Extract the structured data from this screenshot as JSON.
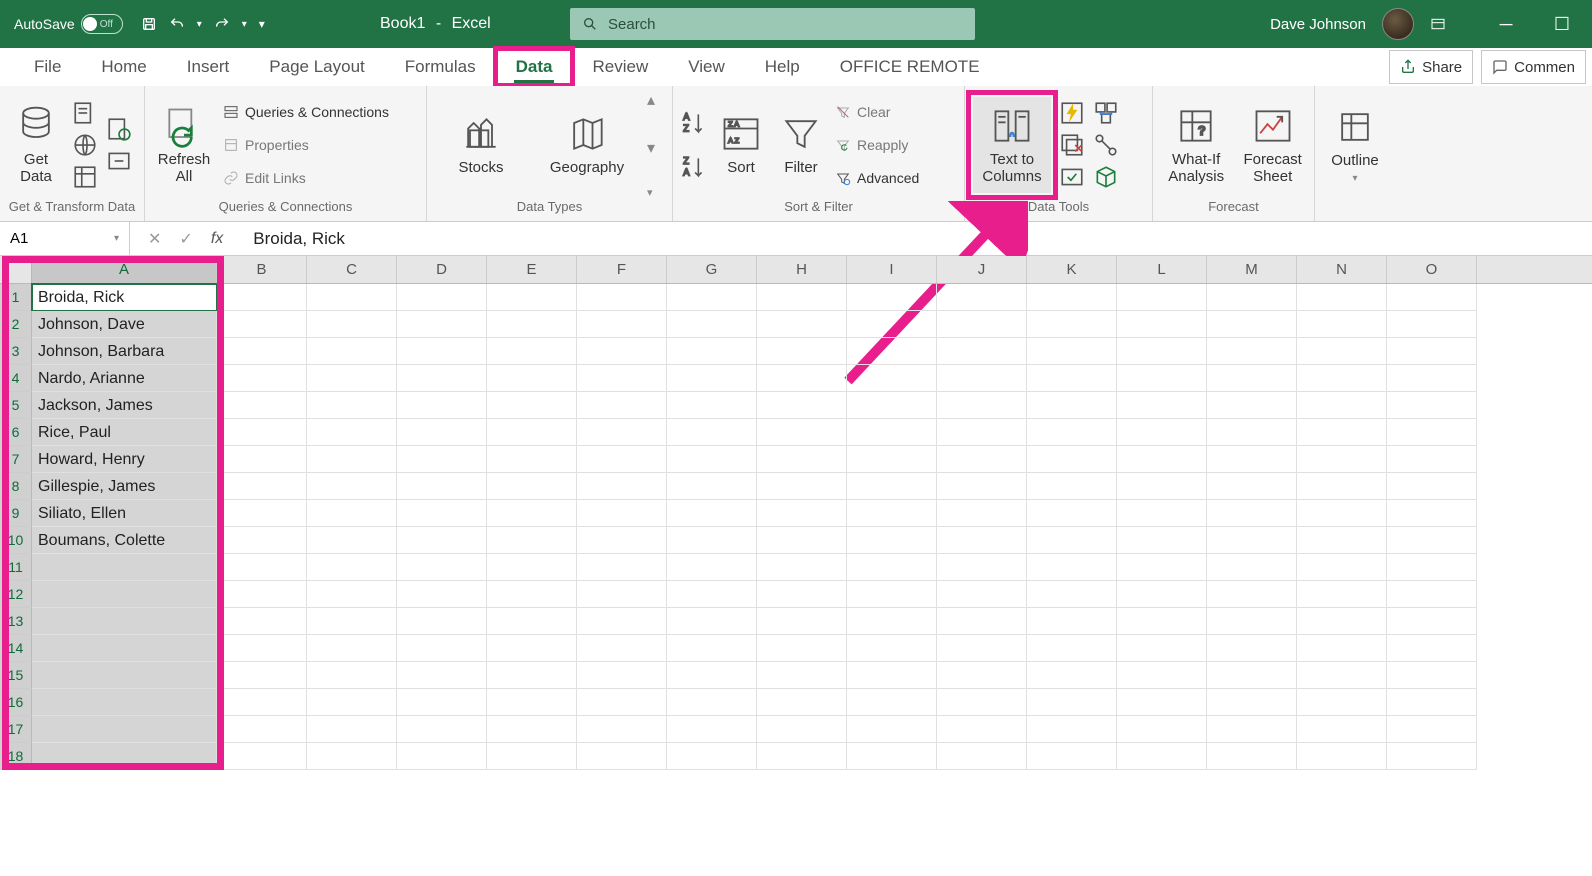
{
  "titlebar": {
    "autosave_label": "AutoSave",
    "autosave_state": "Off",
    "book_name": "Book1",
    "app_name": "Excel",
    "search_placeholder": "Search",
    "username": "Dave Johnson"
  },
  "tabs": {
    "file": "File",
    "home": "Home",
    "insert": "Insert",
    "page_layout": "Page Layout",
    "formulas": "Formulas",
    "data": "Data",
    "review": "Review",
    "view": "View",
    "help": "Help",
    "office_remote": "OFFICE REMOTE",
    "share": "Share",
    "comment": "Commen"
  },
  "ribbon": {
    "get_transform": {
      "get_data": "Get\nData",
      "label": "Get & Transform Data"
    },
    "queries": {
      "refresh_all": "Refresh\nAll",
      "queries_connections": "Queries & Connections",
      "properties": "Properties",
      "edit_links": "Edit Links",
      "label": "Queries & Connections"
    },
    "data_types": {
      "stocks": "Stocks",
      "geography": "Geography",
      "label": "Data Types"
    },
    "sort_filter": {
      "sort": "Sort",
      "filter": "Filter",
      "clear": "Clear",
      "reapply": "Reapply",
      "advanced": "Advanced",
      "label": "Sort & Filter"
    },
    "data_tools": {
      "text_to_columns": "Text to\nColumns",
      "label": "Data Tools"
    },
    "forecast": {
      "what_if": "What-If\nAnalysis",
      "forecast_sheet": "Forecast\nSheet",
      "label": "Forecast"
    },
    "outline": {
      "outline": "Outline"
    }
  },
  "formula_bar": {
    "name_box": "A1",
    "formula": "Broida, Rick"
  },
  "grid": {
    "columns": [
      "A",
      "B",
      "C",
      "D",
      "E",
      "F",
      "G",
      "H",
      "I",
      "J",
      "K",
      "L",
      "M",
      "N",
      "O"
    ],
    "rows": [
      {
        "n": 1,
        "A": "Broida, Rick"
      },
      {
        "n": 2,
        "A": "Johnson, Dave"
      },
      {
        "n": 3,
        "A": "Johnson, Barbara"
      },
      {
        "n": 4,
        "A": "Nardo, Arianne"
      },
      {
        "n": 5,
        "A": "Jackson, James"
      },
      {
        "n": 6,
        "A": "Rice, Paul"
      },
      {
        "n": 7,
        "A": "Howard, Henry"
      },
      {
        "n": 8,
        "A": "Gillespie, James"
      },
      {
        "n": 9,
        "A": "Siliato, Ellen"
      },
      {
        "n": 10,
        "A": "Boumans, Colette"
      },
      {
        "n": 11,
        "A": ""
      },
      {
        "n": 12,
        "A": ""
      },
      {
        "n": 13,
        "A": ""
      },
      {
        "n": 14,
        "A": ""
      },
      {
        "n": 15,
        "A": ""
      },
      {
        "n": 16,
        "A": ""
      },
      {
        "n": 17,
        "A": ""
      },
      {
        "n": 18,
        "A": ""
      }
    ],
    "selected_range": "A1:A18",
    "active_cell": "A1"
  }
}
